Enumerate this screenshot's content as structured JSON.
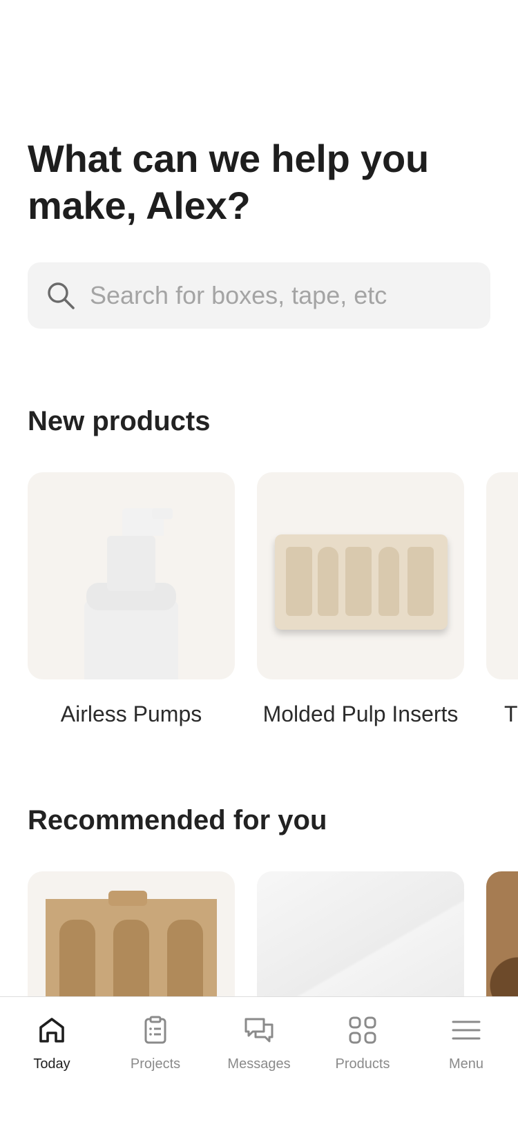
{
  "header": {
    "headline": "What can we help you make, Alex?"
  },
  "search": {
    "placeholder": "Search for boxes, tape, etc",
    "icon": "search-icon"
  },
  "sections": {
    "new_products": {
      "title": "New products",
      "items": [
        {
          "label": "Airless Pumps"
        },
        {
          "label": "Molded Pulp Inserts"
        },
        {
          "label": "T"
        }
      ]
    },
    "recommended": {
      "title": "Recommended for you"
    }
  },
  "nav": {
    "items": [
      {
        "label": "Today",
        "icon": "home-icon",
        "active": true
      },
      {
        "label": "Projects",
        "icon": "clipboard-icon",
        "active": false
      },
      {
        "label": "Messages",
        "icon": "chat-bubbles-icon",
        "active": false
      },
      {
        "label": "Products",
        "icon": "grid-icon",
        "active": false
      },
      {
        "label": "Menu",
        "icon": "hamburger-menu-icon",
        "active": false
      }
    ]
  },
  "colors": {
    "text": "#1e1e1e",
    "muted": "#8a8a8a",
    "search_bg": "#f3f3f3",
    "card_bg": "#f6f3ef"
  }
}
